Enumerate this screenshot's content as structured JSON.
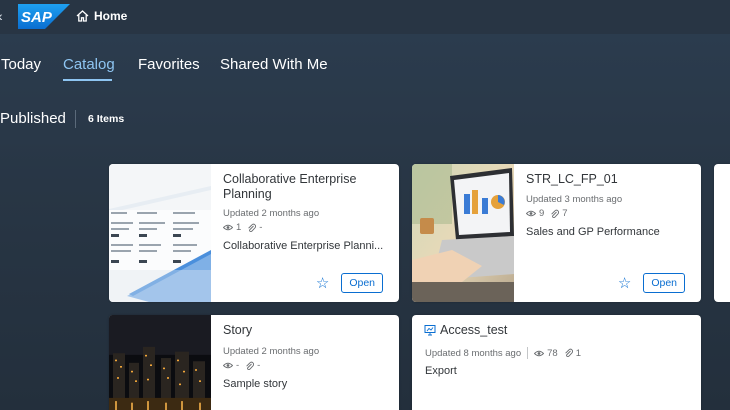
{
  "shell": {
    "logo_text": "SAP",
    "home_label": "Home"
  },
  "tabs": [
    {
      "label": "Today"
    },
    {
      "label": "Catalog"
    },
    {
      "label": "Favorites"
    },
    {
      "label": "Shared With Me"
    }
  ],
  "active_tab": "Catalog",
  "section": {
    "title": "Published",
    "count": "6 Items"
  },
  "cards": [
    {
      "title": "Collaborative Enterprise Planning",
      "updated": "Updated 2 months ago",
      "views": "1",
      "attachments": "-",
      "description": "Collaborative Enterprise Planni...",
      "open_label": "Open"
    },
    {
      "title": "STR_LC_FP_01",
      "updated": "Updated 3 months ago",
      "views": "9",
      "attachments": "7",
      "description": "Sales and GP Performance",
      "open_label": "Open"
    },
    {
      "title": "Story",
      "updated": "Updated 2 months ago",
      "views": "-",
      "attachments": "-",
      "description": "Sample story"
    },
    {
      "title": "Access_test",
      "updated": "Updated 8 months ago",
      "views": "78",
      "attachments": "1",
      "description": "Export"
    }
  ],
  "colors": {
    "accent": "#0a6ed1",
    "active_tab": "#8ec5f2",
    "shell_bg": "#283544"
  }
}
